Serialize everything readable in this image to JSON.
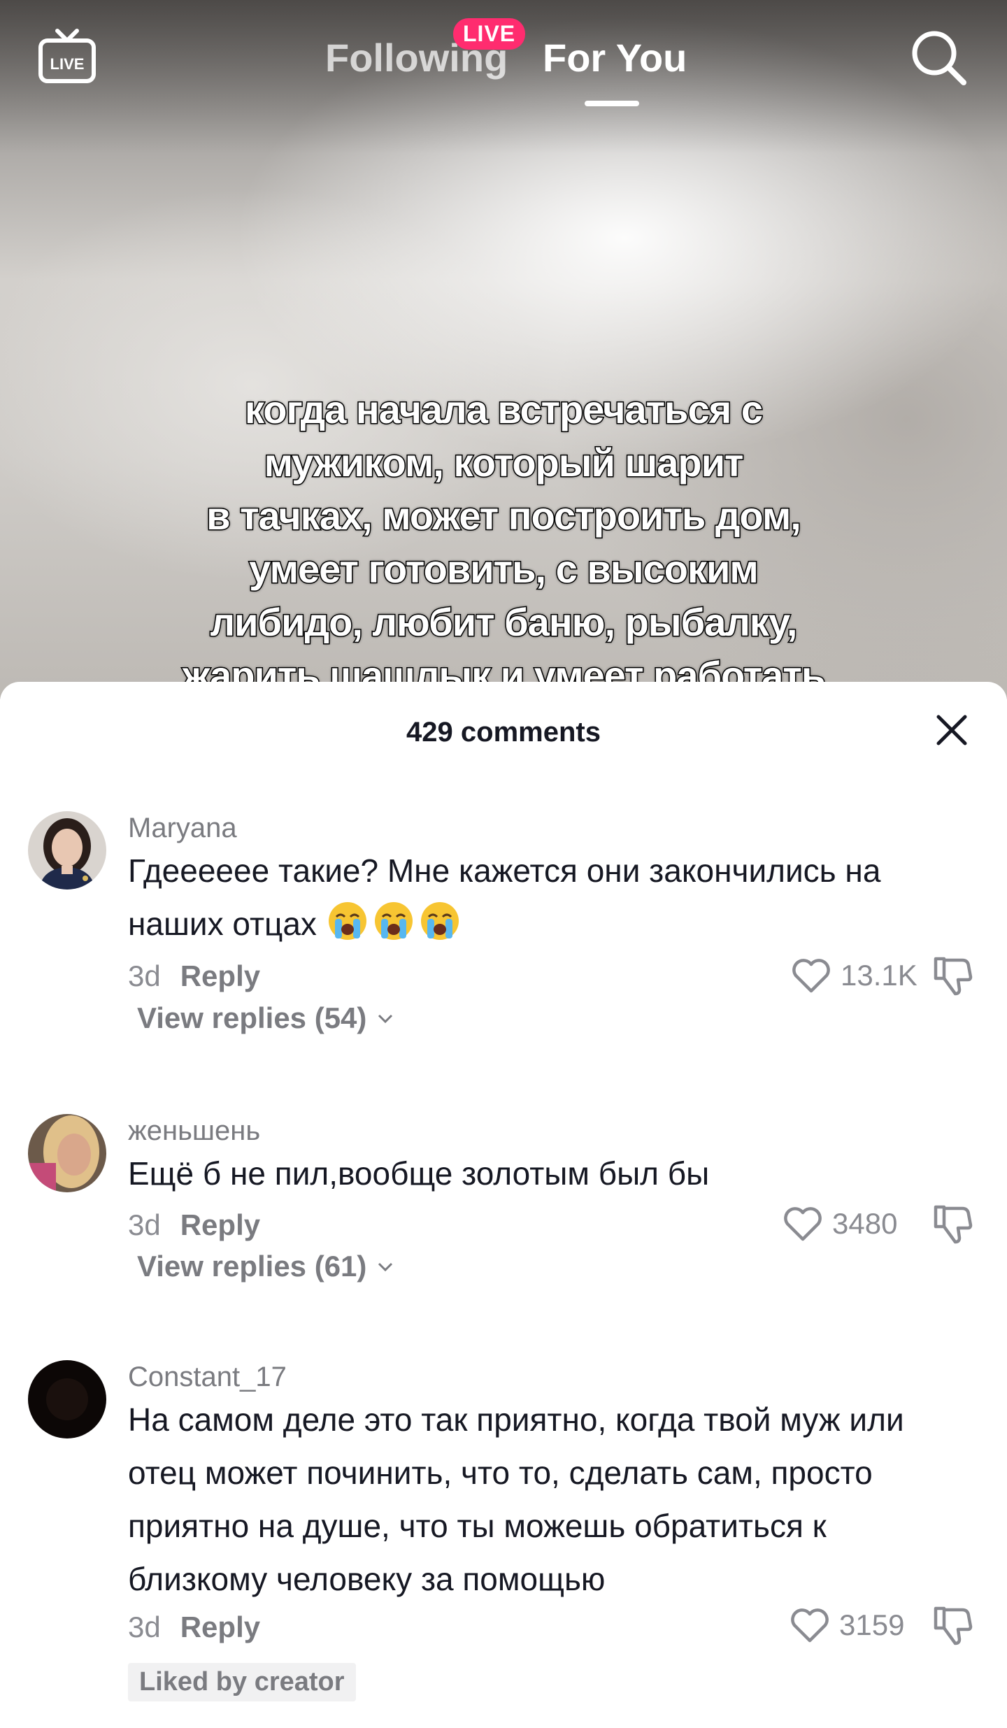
{
  "topnav": {
    "live_label": "LIVE",
    "following_label": "Following",
    "live_badge": "LIVE",
    "foryou_label": "For You"
  },
  "video": {
    "caption_lines": [
      "когда начала встречаться с",
      "мужиком, который шарит",
      "в тачках, может построить дом,",
      "умеет готовить, с высоким",
      "либидо, любит баню, рыбалку,",
      "жарить шашлык и умеет работать"
    ]
  },
  "comments_sheet": {
    "title": "429 comments",
    "comments": [
      {
        "username": "Maryana",
        "text": "Гдееееее такие? Мне кажется они закончились на наших отцах",
        "emoji": [
          "loudly-crying-face",
          "loudly-crying-face",
          "loudly-crying-face"
        ],
        "time": "3d",
        "reply_label": "Reply",
        "likes": "13.1K",
        "view_replies": "View replies (54)"
      },
      {
        "username": "женьшень",
        "text": "Ещё б не пил,вообще золотым был бы",
        "time": "3d",
        "reply_label": "Reply",
        "likes": "3480",
        "view_replies": "View replies (61)"
      },
      {
        "username": "Constant_17",
        "text": "На самом деле это так приятно, когда твой муж или отец может починить, что то, сделать сам, просто приятно на душе, что ты можешь обратиться к близкому человеку за помощью",
        "time": "3d",
        "reply_label": "Reply",
        "likes": "3159",
        "badge": "Liked by creator"
      }
    ]
  },
  "colors": {
    "live_badge": "#ff2c6f",
    "text_primary": "#161823",
    "text_secondary": "#7a7b80"
  }
}
